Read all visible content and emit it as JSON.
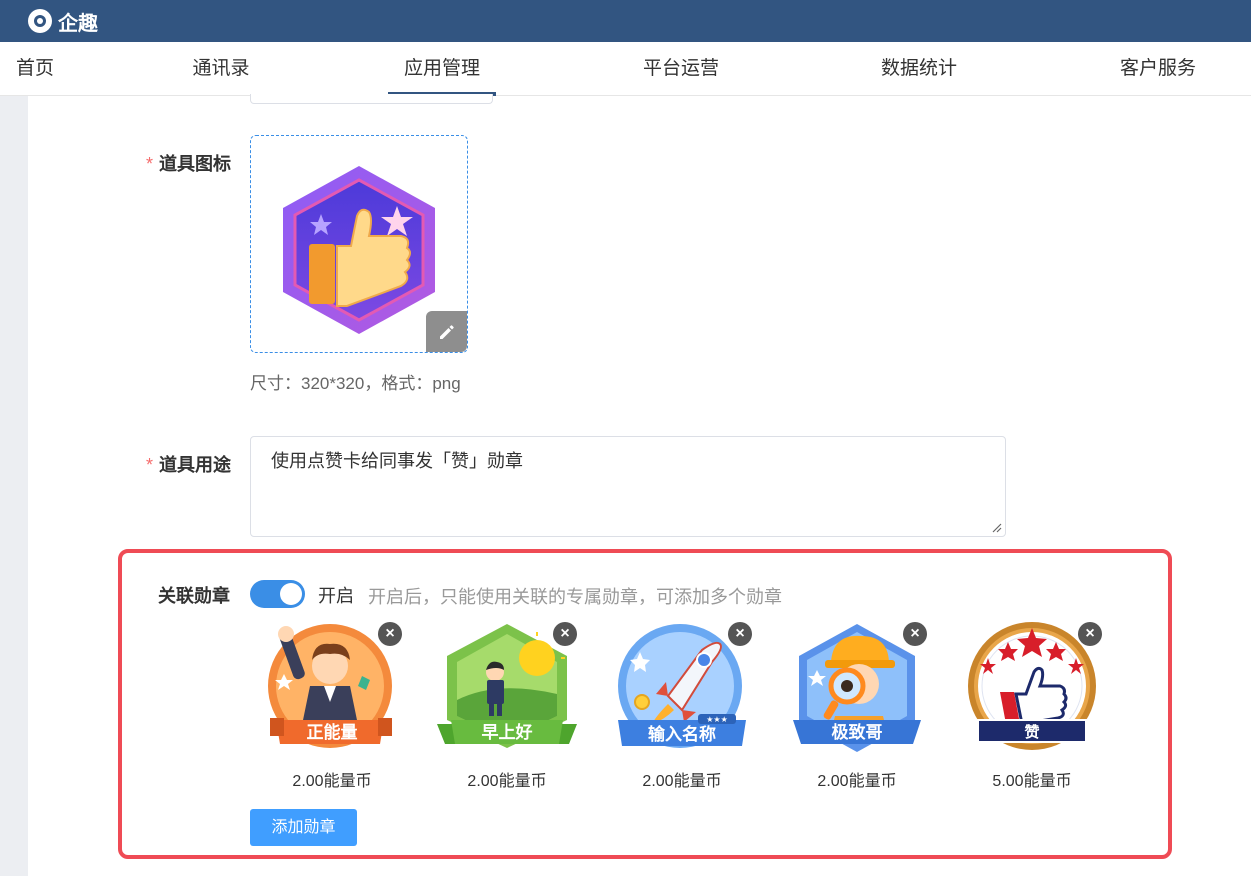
{
  "app": {
    "name": "企趣"
  },
  "nav": {
    "items": [
      {
        "label": "首页"
      },
      {
        "label": "通讯录"
      },
      {
        "label": "应用管理"
      },
      {
        "label": "平台运营"
      },
      {
        "label": "数据统计"
      },
      {
        "label": "客户服务"
      }
    ],
    "active_index": 2
  },
  "form": {
    "icon_label": "道具图标",
    "icon_hint": "尺寸：320*320，格式：png",
    "usage_label": "道具用途",
    "usage_value": "使用点赞卡给同事发「赞」勋章",
    "required_mark": "*"
  },
  "medals_section": {
    "label": "关联勋章",
    "switch_on": true,
    "switch_text": "开启",
    "description": "开启后，只能使用关联的专属勋章，可添加多个勋章",
    "add_button": "添加勋章",
    "close_glyph": "×",
    "medals": [
      {
        "name": "正能量",
        "price": "2.00能量币",
        "icon": "fist-raised-person-medal-icon"
      },
      {
        "name": "早上好",
        "price": "2.00能量币",
        "icon": "sunrise-person-medal-icon"
      },
      {
        "name": "输入名称",
        "price": "2.00能量币",
        "icon": "rocket-medal-icon"
      },
      {
        "name": "极致哥",
        "price": "2.00能量币",
        "icon": "magnifier-person-medal-icon"
      },
      {
        "name": "赞",
        "price": "5.00能量币",
        "icon": "thumbs-up-stars-medal-icon"
      }
    ]
  },
  "colors": {
    "topbar": "#325581",
    "primary": "#409eff",
    "highlight_border": "#ef4b55",
    "required": "#f56c6c"
  }
}
